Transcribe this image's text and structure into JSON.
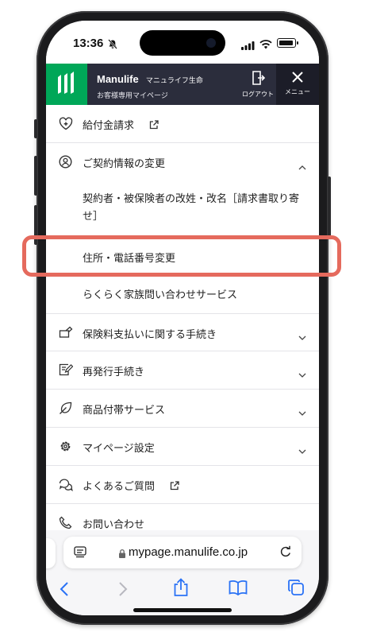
{
  "status_bar": {
    "time": "13:36"
  },
  "header": {
    "brand_name": "Manulife",
    "brand_sub": "マニュライフ生命",
    "site_name": "お客様専用マイページ",
    "logout_label": "ログアウト",
    "menu_label": "メニュー",
    "colors": {
      "header_bg": "#2b2d3c",
      "logo_green": "#00a758"
    }
  },
  "menu": {
    "items": [
      {
        "label": "給付金請求",
        "icon": "heart-plus-icon",
        "external": true
      },
      {
        "label": "ご契約情報の変更",
        "icon": "user-circle-icon",
        "expanded": true,
        "children": [
          "契約者・被保険者の改姓・改名［請求書取り寄せ］",
          "住所・電話番号変更",
          "らくらく家族問い合わせサービス"
        ]
      },
      {
        "label": "保険料支払いに関する手続き",
        "icon": "card-hand-icon"
      },
      {
        "label": "再発行手続き",
        "icon": "document-edit-icon"
      },
      {
        "label": "商品付帯サービス",
        "icon": "leaf-icon"
      },
      {
        "label": "マイページ設定",
        "icon": "gear-icon"
      },
      {
        "label": "よくあるご質問",
        "icon": "chat-bubbles-icon",
        "external": true
      },
      {
        "label": "お問い合わせ",
        "icon": "phone-icon"
      }
    ],
    "highlighted_item": "住所・電話番号変更",
    "highlight_color": "#e56a5d"
  },
  "browser": {
    "url": "mypage.manulife.co.jp"
  }
}
